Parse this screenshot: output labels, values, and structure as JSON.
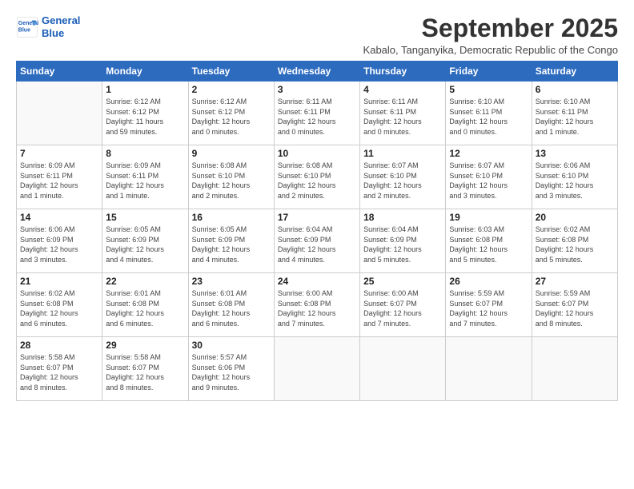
{
  "logo": {
    "line1": "General",
    "line2": "Blue"
  },
  "title": "September 2025",
  "subtitle": "Kabalo, Tanganyika, Democratic Republic of the Congo",
  "days_of_week": [
    "Sunday",
    "Monday",
    "Tuesday",
    "Wednesday",
    "Thursday",
    "Friday",
    "Saturday"
  ],
  "weeks": [
    [
      {
        "day": "",
        "info": ""
      },
      {
        "day": "1",
        "info": "Sunrise: 6:12 AM\nSunset: 6:12 PM\nDaylight: 11 hours\nand 59 minutes."
      },
      {
        "day": "2",
        "info": "Sunrise: 6:12 AM\nSunset: 6:12 PM\nDaylight: 12 hours\nand 0 minutes."
      },
      {
        "day": "3",
        "info": "Sunrise: 6:11 AM\nSunset: 6:11 PM\nDaylight: 12 hours\nand 0 minutes."
      },
      {
        "day": "4",
        "info": "Sunrise: 6:11 AM\nSunset: 6:11 PM\nDaylight: 12 hours\nand 0 minutes."
      },
      {
        "day": "5",
        "info": "Sunrise: 6:10 AM\nSunset: 6:11 PM\nDaylight: 12 hours\nand 0 minutes."
      },
      {
        "day": "6",
        "info": "Sunrise: 6:10 AM\nSunset: 6:11 PM\nDaylight: 12 hours\nand 1 minute."
      }
    ],
    [
      {
        "day": "7",
        "info": "Sunrise: 6:09 AM\nSunset: 6:11 PM\nDaylight: 12 hours\nand 1 minute."
      },
      {
        "day": "8",
        "info": "Sunrise: 6:09 AM\nSunset: 6:11 PM\nDaylight: 12 hours\nand 1 minute."
      },
      {
        "day": "9",
        "info": "Sunrise: 6:08 AM\nSunset: 6:10 PM\nDaylight: 12 hours\nand 2 minutes."
      },
      {
        "day": "10",
        "info": "Sunrise: 6:08 AM\nSunset: 6:10 PM\nDaylight: 12 hours\nand 2 minutes."
      },
      {
        "day": "11",
        "info": "Sunrise: 6:07 AM\nSunset: 6:10 PM\nDaylight: 12 hours\nand 2 minutes."
      },
      {
        "day": "12",
        "info": "Sunrise: 6:07 AM\nSunset: 6:10 PM\nDaylight: 12 hours\nand 3 minutes."
      },
      {
        "day": "13",
        "info": "Sunrise: 6:06 AM\nSunset: 6:10 PM\nDaylight: 12 hours\nand 3 minutes."
      }
    ],
    [
      {
        "day": "14",
        "info": "Sunrise: 6:06 AM\nSunset: 6:09 PM\nDaylight: 12 hours\nand 3 minutes."
      },
      {
        "day": "15",
        "info": "Sunrise: 6:05 AM\nSunset: 6:09 PM\nDaylight: 12 hours\nand 4 minutes."
      },
      {
        "day": "16",
        "info": "Sunrise: 6:05 AM\nSunset: 6:09 PM\nDaylight: 12 hours\nand 4 minutes."
      },
      {
        "day": "17",
        "info": "Sunrise: 6:04 AM\nSunset: 6:09 PM\nDaylight: 12 hours\nand 4 minutes."
      },
      {
        "day": "18",
        "info": "Sunrise: 6:04 AM\nSunset: 6:09 PM\nDaylight: 12 hours\nand 5 minutes."
      },
      {
        "day": "19",
        "info": "Sunrise: 6:03 AM\nSunset: 6:08 PM\nDaylight: 12 hours\nand 5 minutes."
      },
      {
        "day": "20",
        "info": "Sunrise: 6:02 AM\nSunset: 6:08 PM\nDaylight: 12 hours\nand 5 minutes."
      }
    ],
    [
      {
        "day": "21",
        "info": "Sunrise: 6:02 AM\nSunset: 6:08 PM\nDaylight: 12 hours\nand 6 minutes."
      },
      {
        "day": "22",
        "info": "Sunrise: 6:01 AM\nSunset: 6:08 PM\nDaylight: 12 hours\nand 6 minutes."
      },
      {
        "day": "23",
        "info": "Sunrise: 6:01 AM\nSunset: 6:08 PM\nDaylight: 12 hours\nand 6 minutes."
      },
      {
        "day": "24",
        "info": "Sunrise: 6:00 AM\nSunset: 6:08 PM\nDaylight: 12 hours\nand 7 minutes."
      },
      {
        "day": "25",
        "info": "Sunrise: 6:00 AM\nSunset: 6:07 PM\nDaylight: 12 hours\nand 7 minutes."
      },
      {
        "day": "26",
        "info": "Sunrise: 5:59 AM\nSunset: 6:07 PM\nDaylight: 12 hours\nand 7 minutes."
      },
      {
        "day": "27",
        "info": "Sunrise: 5:59 AM\nSunset: 6:07 PM\nDaylight: 12 hours\nand 8 minutes."
      }
    ],
    [
      {
        "day": "28",
        "info": "Sunrise: 5:58 AM\nSunset: 6:07 PM\nDaylight: 12 hours\nand 8 minutes."
      },
      {
        "day": "29",
        "info": "Sunrise: 5:58 AM\nSunset: 6:07 PM\nDaylight: 12 hours\nand 8 minutes."
      },
      {
        "day": "30",
        "info": "Sunrise: 5:57 AM\nSunset: 6:06 PM\nDaylight: 12 hours\nand 9 minutes."
      },
      {
        "day": "",
        "info": ""
      },
      {
        "day": "",
        "info": ""
      },
      {
        "day": "",
        "info": ""
      },
      {
        "day": "",
        "info": ""
      }
    ]
  ]
}
